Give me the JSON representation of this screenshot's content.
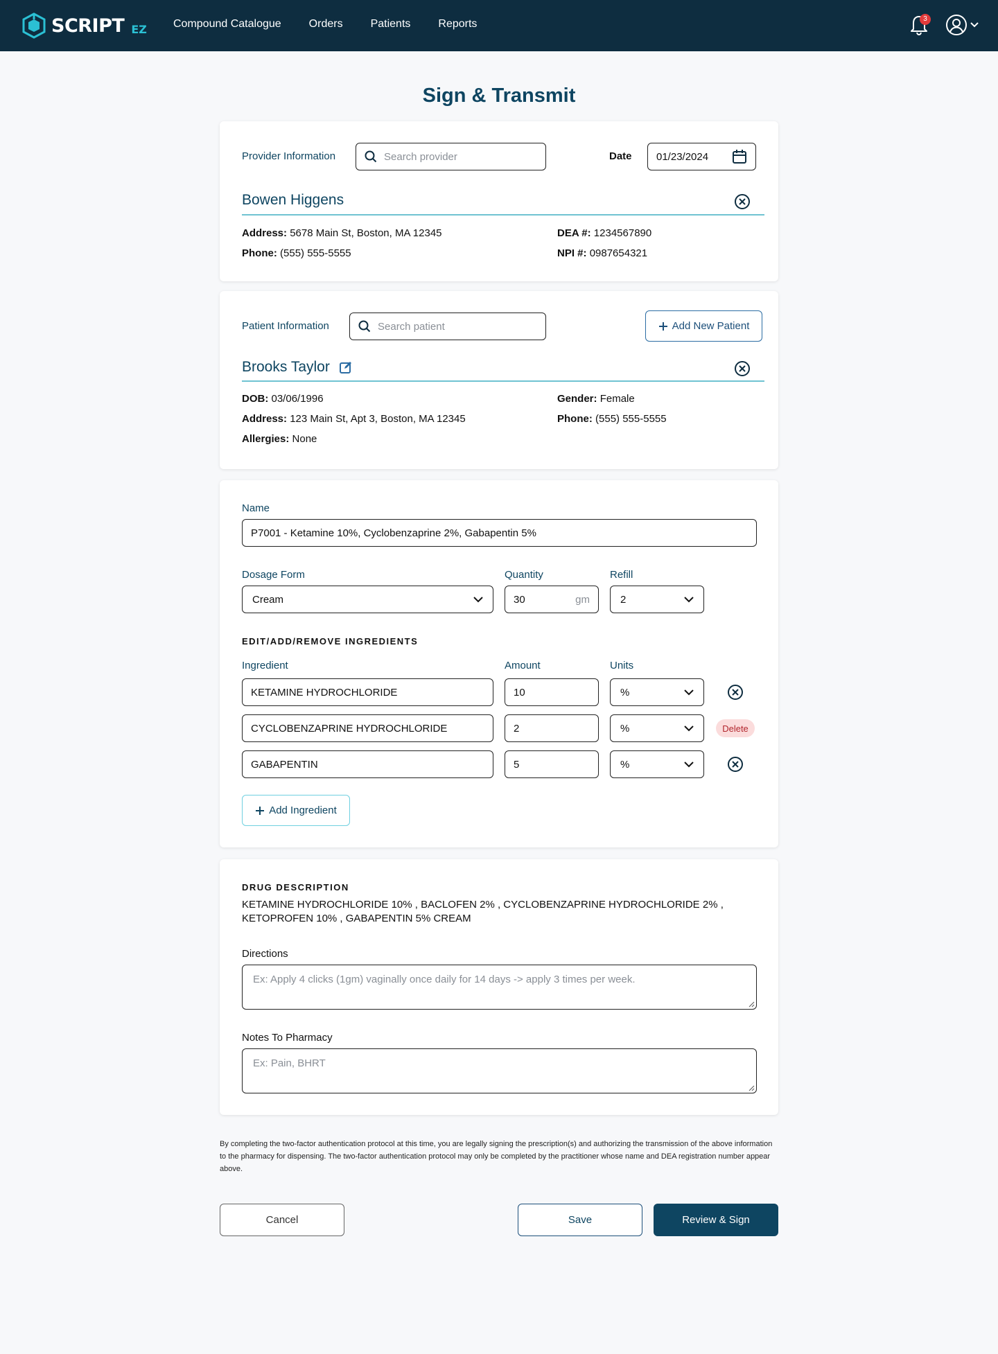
{
  "nav": {
    "logo_text": "SCRIPT",
    "logo_sub": "EZ",
    "items": [
      "Compound Catalogue",
      "Orders",
      "Patients",
      "Reports"
    ],
    "notification_count": "3"
  },
  "page_title": "Sign & Transmit",
  "provider": {
    "section_label": "Provider Information",
    "search_placeholder": "Search provider",
    "date_label": "Date",
    "date_value": "01/23/2024",
    "name": "Bowen Higgens",
    "address_label": "Address:",
    "address": "5678 Main St, Boston, MA 12345",
    "phone_label": "Phone:",
    "phone": "(555) 555-5555",
    "dea_label": "DEA #:",
    "dea": "1234567890",
    "npi_label": "NPI #:",
    "npi": "0987654321"
  },
  "patient": {
    "section_label": "Patient Information",
    "search_placeholder": "Search patient",
    "add_button": "Add New Patient",
    "name": "Brooks Taylor",
    "dob_label": "DOB:",
    "dob": "03/06/1996",
    "address_label": "Address:",
    "address": "123 Main St, Apt 3, Boston, MA 12345",
    "allergies_label": "Allergies:",
    "allergies": "None",
    "gender_label": "Gender:",
    "gender": "Female",
    "phone_label": "Phone:",
    "phone": "(555) 555-5555"
  },
  "compound": {
    "name_label": "Name",
    "name_value": "P7001 - Ketamine 10%, Cyclobenzaprine 2%, Gabapentin 5%",
    "dosage_label": "Dosage Form",
    "dosage_value": "Cream",
    "quantity_label": "Quantity",
    "quantity_value": "30",
    "quantity_unit": "gm",
    "refill_label": "Refill",
    "refill_value": "2",
    "ingredients_heading": "EDIT/ADD/REMOVE INGREDIENTS",
    "col_ingredient": "Ingredient",
    "col_amount": "Amount",
    "col_units": "Units",
    "ingredients": [
      {
        "name": "KETAMINE HYDROCHLORIDE",
        "amount": "10",
        "unit": "%",
        "action": "remove"
      },
      {
        "name": "CYCLOBENZAPRINE HYDROCHLORIDE",
        "amount": "2",
        "unit": "%",
        "action": "Delete"
      },
      {
        "name": "GABAPENTIN",
        "amount": "5",
        "unit": "%",
        "action": "remove"
      }
    ],
    "add_ingredient": "Add Ingredient"
  },
  "description": {
    "heading": "DRUG DESCRIPTION",
    "line1": "KETAMINE HYDROCHLORIDE 10% , BACLOFEN 2% , CYCLOBENZAPRINE HYDROCHLORIDE 2% ,",
    "line2": "KETOPROFEN 10% , GABAPENTIN 5% CREAM",
    "directions_label": "Directions",
    "directions_placeholder": "Ex: Apply 4 clicks (1gm) vaginally once daily for 14 days -> apply 3 times per week.",
    "notes_label": "Notes To Pharmacy",
    "notes_placeholder": "Ex: Pain, BHRT"
  },
  "legal_text": "By completing the two-factor authentication protocol at this time, you are legally signing the prescription(s) and authorizing the transmission of the above information to the pharmacy for dispensing. The two-factor authentication protocol may only be completed by the practitioner whose name and DEA registration number appear above.",
  "actions": {
    "cancel": "Cancel",
    "save": "Save",
    "review": "Review & Sign"
  },
  "colors": {
    "topbar": "#0e2d40",
    "primary": "#0e4561",
    "accent": "#2bc0d4",
    "delete_bg": "#fbdcdc",
    "delete_text": "#b2262d"
  },
  "icons": [
    "logo-icon",
    "bell-icon",
    "user-circle-icon",
    "chevron-down-icon",
    "search-icon",
    "calendar-icon",
    "close-circle-icon",
    "edit-icon",
    "plus-icon",
    "resize-handle-icon"
  ]
}
